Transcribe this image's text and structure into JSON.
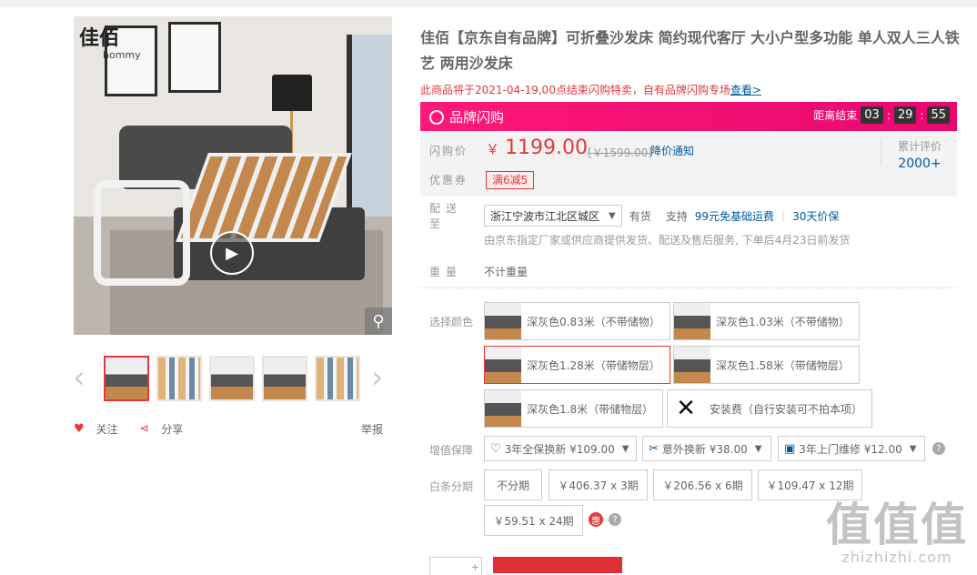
{
  "gallery": {
    "logo_text": "佳佰",
    "logo_sub": "hommy",
    "video_icon": "play-icon",
    "zoom_icon": "magnifier-icon",
    "thumbnail_count": 5,
    "selected_thumbnail": 1
  },
  "actions": {
    "follow_label": "关注",
    "share_label": "分享",
    "report_label": "举报"
  },
  "product": {
    "title_line1": "佳佰【京东自有品牌】可折叠沙发床 简约现代客厅 大小户型多功能 单人双人三人铁",
    "title_line2": "艺 两用沙发床",
    "notice_text": "此商品将于2021-04-19,00点结束闪购特卖，自有品牌闪购专场",
    "notice_link": "查看>"
  },
  "flash": {
    "title": "品牌闪购",
    "countdown_label": "距离结束",
    "hours": "03",
    "minutes": "29",
    "seconds": "55",
    "colors": {
      "start": "#ff1877",
      "end": "#e8086f"
    }
  },
  "price": {
    "label": "闪购价",
    "currency": "￥",
    "value": "1199.00",
    "original_text": "[￥1599.00]",
    "notify_label": "降价通知",
    "coupon_label": "优惠券",
    "coupon_value": "满6减5",
    "rating_label": "累计评价",
    "rating_value": "2000+"
  },
  "delivery": {
    "label": "配送至",
    "address": "浙江宁波市江北区城区",
    "stock": "有货",
    "support_label": "支持",
    "freight": "99元免基础运费",
    "separator": "|",
    "warranty": "30天价保",
    "note": "由京东指定厂家或供应商提供发货、配送及售后服务, 下单后4月23日前发货"
  },
  "weight": {
    "label": "重量",
    "value": "不计重量"
  },
  "color": {
    "label": "选择颜色",
    "options": [
      {
        "text": "深灰色0.83米（不带储物）"
      },
      {
        "text": "深灰色1.03米（不带储物）"
      },
      {
        "text": "深灰色1.28米（带储物层）"
      },
      {
        "text": "深灰色1.58米（带储物层）"
      },
      {
        "text": "深灰色1.8米（带储物层）"
      },
      {
        "text": "安装费（自行安装可不拍本项）"
      }
    ],
    "selected_index": 2
  },
  "services": {
    "label": "增值保障",
    "items": [
      {
        "text": "3年全保换新 ¥109.00",
        "icon": "shield-heart-icon"
      },
      {
        "text": "意外换新 ¥38.00",
        "icon": "tools-icon"
      },
      {
        "text": "3年上门维修 ¥12.00",
        "icon": "repair-icon"
      }
    ],
    "help_icon": "question-icon"
  },
  "installments": {
    "label": "白条分期",
    "items": [
      {
        "text": "不分期"
      },
      {
        "text": "￥406.37 x 3期"
      },
      {
        "text": "￥206.56 x 6期"
      },
      {
        "text": "￥109.47 x 12期"
      },
      {
        "text": "￥59.51 x 24期"
      }
    ],
    "badge_text": "惠"
  },
  "cart": {
    "plus": "+"
  },
  "watermark": {
    "line1": "值值值",
    "line2": "zhizhizhi.com"
  }
}
